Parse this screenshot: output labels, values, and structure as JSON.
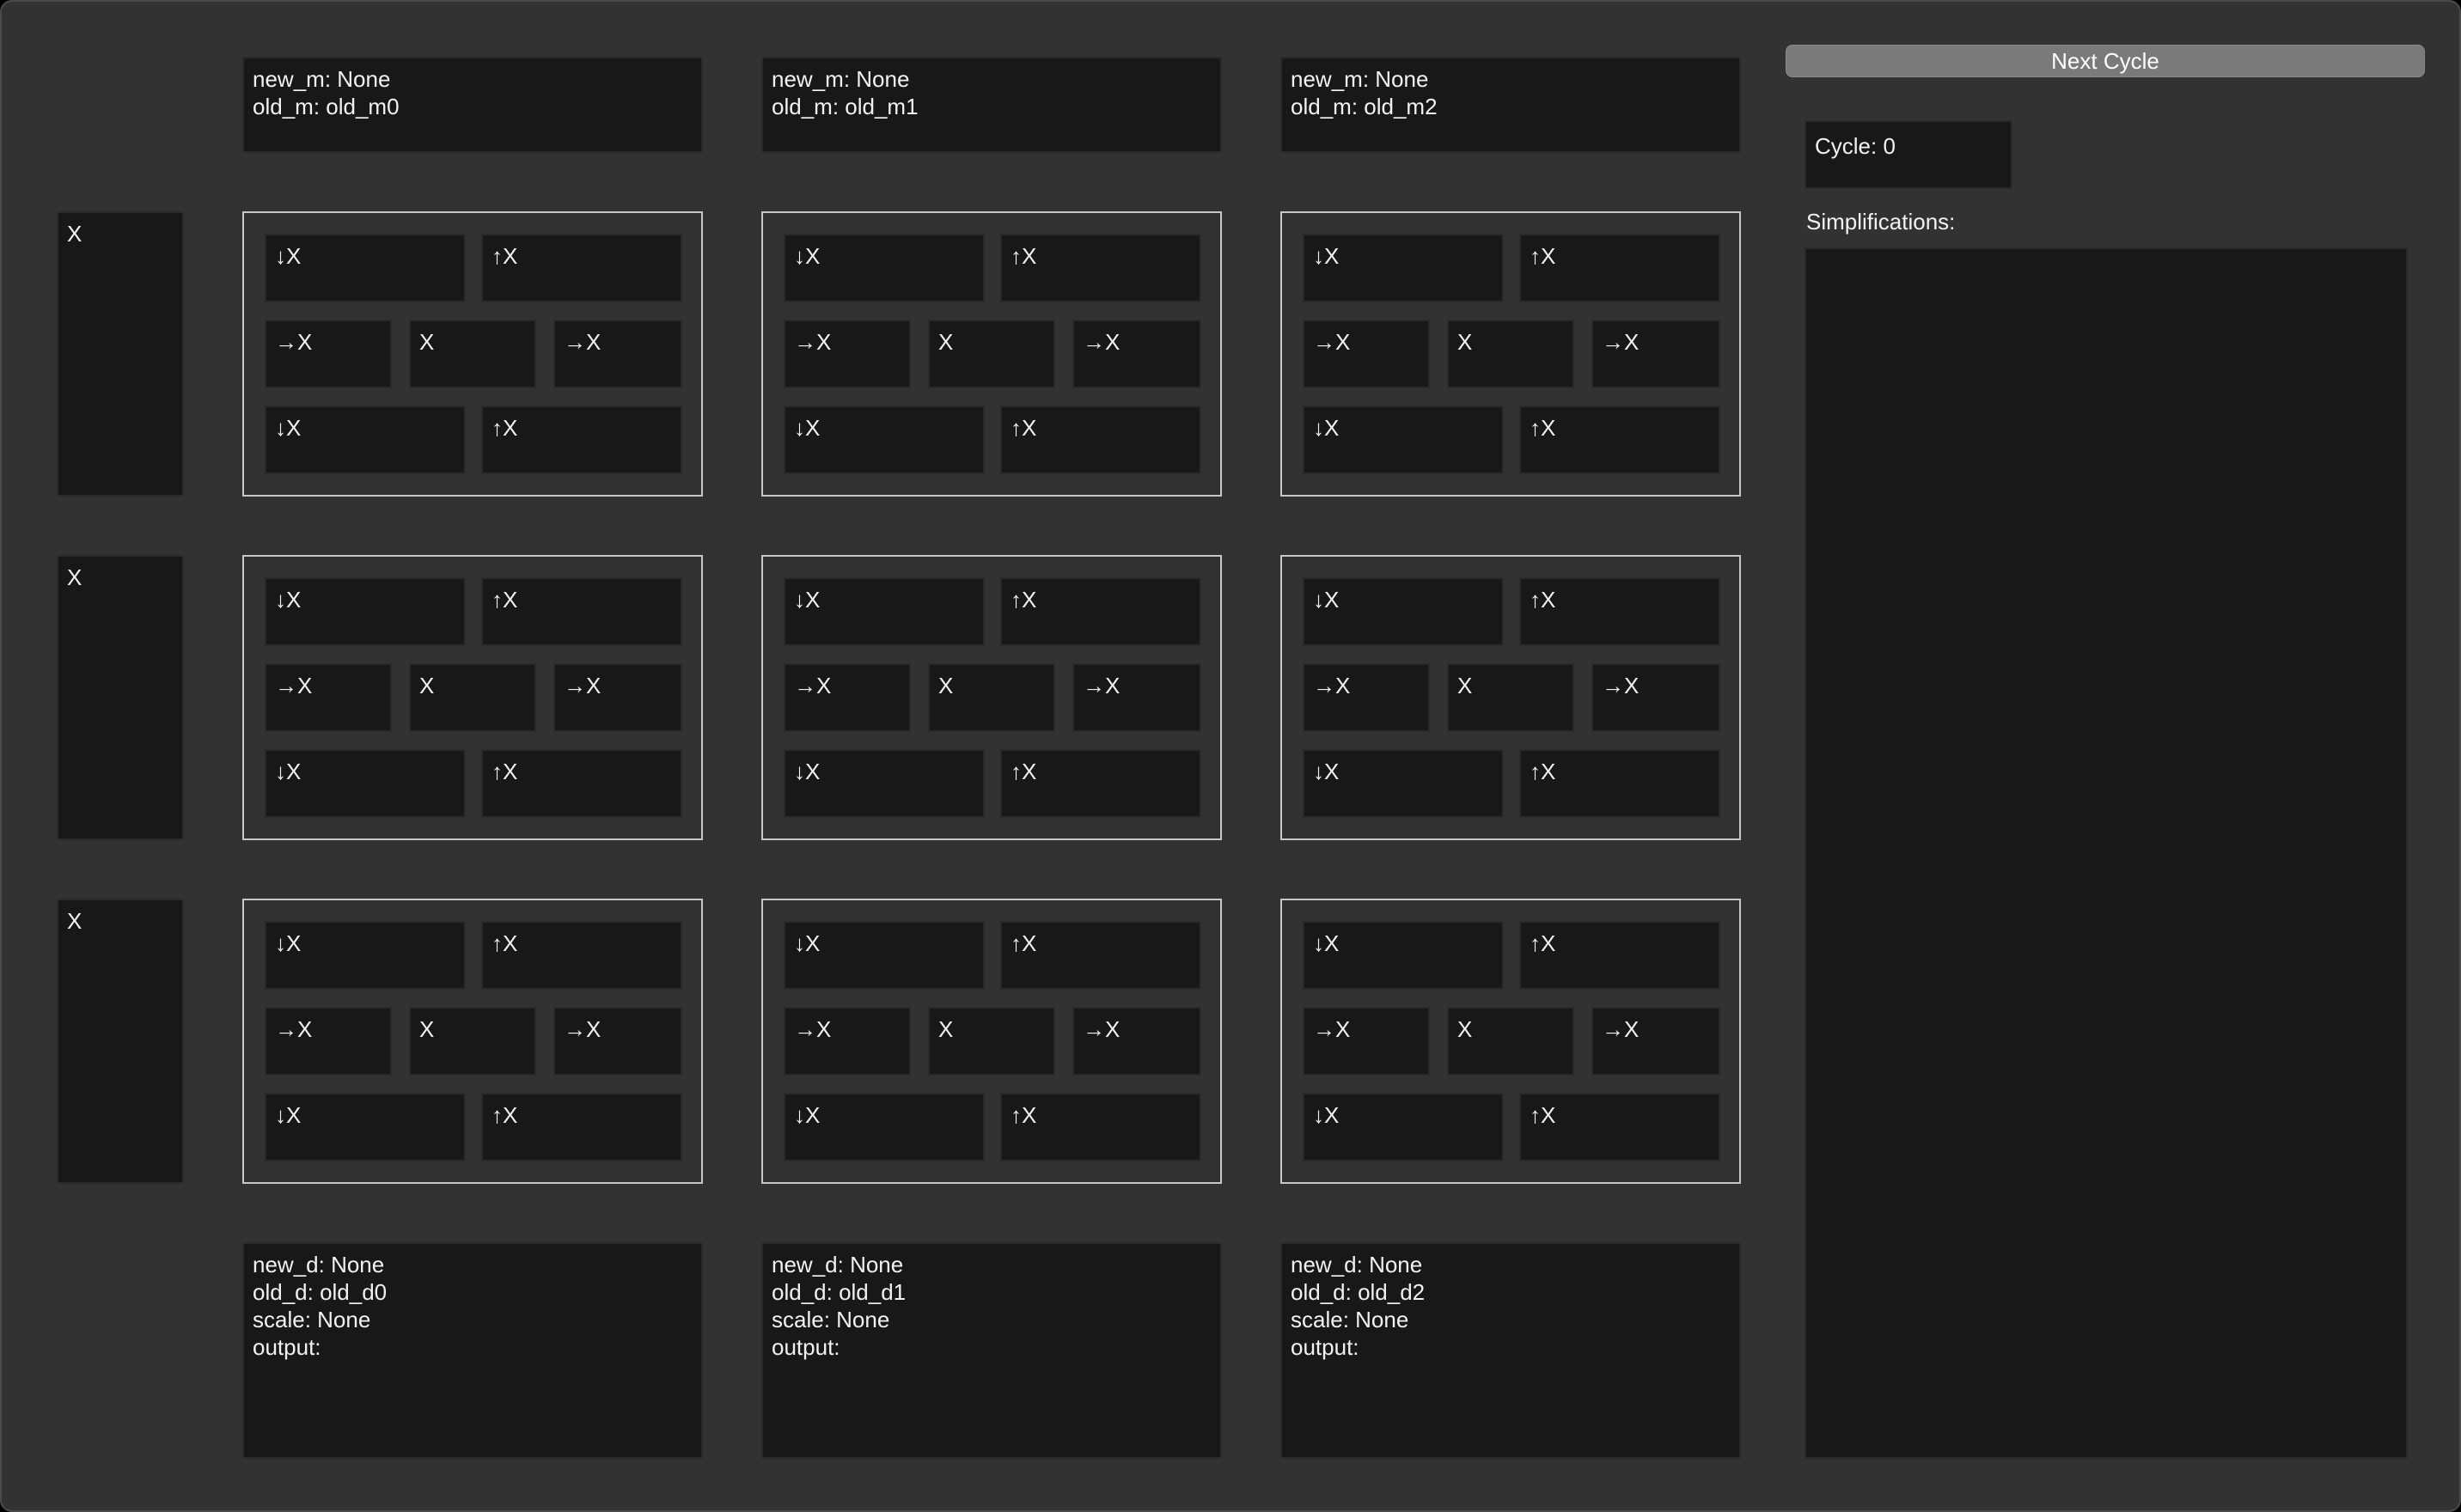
{
  "controls": {
    "next_cycle_label": "Next Cycle",
    "cycle_text": "Cycle: 0",
    "simplifications_label": "Simplifications:"
  },
  "top_boxes": [
    {
      "new_m": "new_m: None",
      "old_m": "old_m: old_m0"
    },
    {
      "new_m": "new_m: None",
      "old_m": "old_m: old_m1"
    },
    {
      "new_m": "new_m: None",
      "old_m": "old_m: old_m2"
    }
  ],
  "left_boxes": [
    "X",
    "X",
    "X"
  ],
  "pe_cells": {
    "down": "↓X",
    "up": "↑X",
    "right": "→X",
    "center": "X"
  },
  "bottom_boxes": [
    {
      "new_d": "new_d: None",
      "old_d": "old_d: old_d0",
      "scale": "scale: None",
      "output": "output:"
    },
    {
      "new_d": "new_d: None",
      "old_d": "old_d: old_d1",
      "scale": "scale: None",
      "output": "output:"
    },
    {
      "new_d": "new_d: None",
      "old_d": "old_d: old_d2",
      "scale": "scale: None",
      "output": "output:"
    }
  ]
}
